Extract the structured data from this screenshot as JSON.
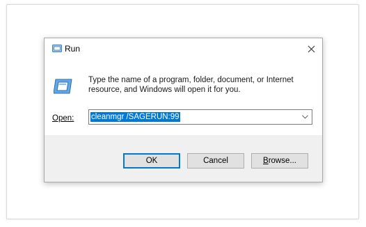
{
  "dialog": {
    "title": "Run",
    "description": "Type the name of a program, folder, document, or Internet resource, and Windows will open it for you.",
    "open_label": "Open:",
    "command_value": "cleanmgr /SAGERUN:99",
    "buttons": {
      "ok": "OK",
      "cancel": "Cancel",
      "browse": "Browse..."
    }
  },
  "colors": {
    "accent": "#0078d7",
    "footer": "#f0f0f0"
  },
  "icons": {
    "title": "run-icon",
    "body": "run-icon",
    "close": "close-icon",
    "dropdown": "chevron-down-icon"
  }
}
